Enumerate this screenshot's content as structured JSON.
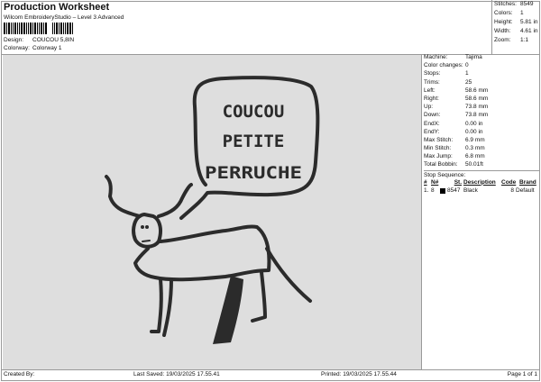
{
  "header": {
    "title": "Production Worksheet",
    "subtitle": "Wilcom EmbroideryStudio – Level 3 Advanced",
    "design_label": "Design:",
    "design_value": "COUCOU 5,8IN",
    "colorway_label": "Colorway:",
    "colorway_value": "Colorway 1"
  },
  "stats": [
    {
      "label": "Stitches:",
      "value": "8549"
    },
    {
      "label": "Colors:",
      "value": "1"
    },
    {
      "label": "Height:",
      "value": "5.81 in"
    },
    {
      "label": "Width:",
      "value": "4.61 in"
    },
    {
      "label": "Zoom:",
      "value": "1:1"
    }
  ],
  "design_text": [
    "COUCOU",
    "PETITE",
    "PERRUCHE"
  ],
  "machine": [
    {
      "label": "Machine:",
      "value": "Tajima"
    },
    {
      "label": "Color changes:",
      "value": "0"
    },
    {
      "label": "Stops:",
      "value": "1"
    },
    {
      "label": "Trims:",
      "value": "25"
    },
    {
      "label": "Left:",
      "value": "58.6 mm"
    },
    {
      "label": "Right:",
      "value": "58.6 mm"
    },
    {
      "label": "Up:",
      "value": "73.8 mm"
    },
    {
      "label": "Down:",
      "value": "73.8 mm"
    },
    {
      "label": "EndX:",
      "value": "0.00 in"
    },
    {
      "label": "EndY:",
      "value": "0.00 in"
    },
    {
      "label": "Max Stitch:",
      "value": "6.9 mm"
    },
    {
      "label": "Min Stitch:",
      "value": "0.3 mm"
    },
    {
      "label": "Max Jump:",
      "value": "6.8 mm"
    },
    {
      "label": "Total Bobbin:",
      "value": "50.01ft"
    }
  ],
  "stop_sequence": {
    "title": "Stop Sequence:",
    "headers": [
      "#",
      "N#",
      "St.",
      "Description",
      "Code",
      "Brand"
    ],
    "rows": [
      {
        "index": "1.",
        "needle": "8",
        "swatch": "#000000",
        "stitches": "8547",
        "description": "Black",
        "code": "8",
        "brand": "Default"
      }
    ]
  },
  "footer": {
    "created_by": "Created By:",
    "last_saved": "Last Saved: 19/03/2025 17.55.41",
    "printed": "Printed: 19/03/2025 17.55.44",
    "page": "Page 1 of 1"
  }
}
